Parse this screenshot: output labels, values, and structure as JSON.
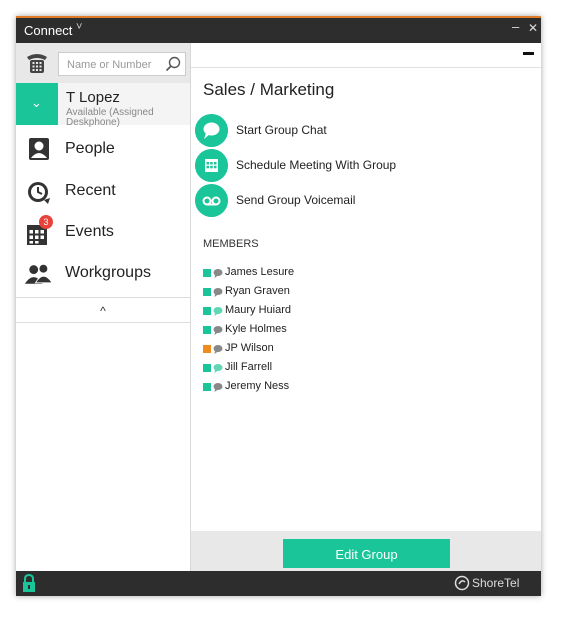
{
  "titlebar": {
    "title": "Connect",
    "chevron": "˅",
    "minimize": "–",
    "close": "✕"
  },
  "search": {
    "placeholder": "Name or Number"
  },
  "user": {
    "name": "T Lopez",
    "status": "Available (Assigned Deskphone)",
    "status_chevron": "⌄"
  },
  "nav": [
    {
      "label": "People",
      "icon": "person-icon"
    },
    {
      "label": "Recent",
      "icon": "clock-icon"
    },
    {
      "label": "Events",
      "icon": "calendar-icon",
      "badge": "3"
    },
    {
      "label": "Workgroups",
      "icon": "group-icon"
    }
  ],
  "collapse_label": "^",
  "group": {
    "title": "Sales / Marketing"
  },
  "actions": [
    {
      "label": "Start Group Chat",
      "icon": "chat-icon"
    },
    {
      "label": "Schedule Meeting With Group",
      "icon": "calendar-grid-icon"
    },
    {
      "label": "Send Group Voicemail",
      "icon": "voicemail-icon"
    }
  ],
  "members_header": "MEMBERS",
  "members": [
    {
      "name": "James Lesure",
      "presence_color": "#1bc59a",
      "chat_color": "#888888"
    },
    {
      "name": "Ryan Graven",
      "presence_color": "#1bc59a",
      "chat_color": "#888888"
    },
    {
      "name": "Maury Huiard",
      "presence_color": "#1bc59a",
      "chat_color": "#5fd6b4"
    },
    {
      "name": "Kyle Holmes",
      "presence_color": "#1bc59a",
      "chat_color": "#888888"
    },
    {
      "name": "JP Wilson",
      "presence_color": "#f08c1e",
      "chat_color": "#888888"
    },
    {
      "name": "Jill Farrell",
      "presence_color": "#1bc59a",
      "chat_color": "#5fd6b4"
    },
    {
      "name": "Jeremy Ness",
      "presence_color": "#1bc59a",
      "chat_color": "#888888"
    }
  ],
  "edit_button": "Edit Group",
  "brand": "ShoreTel",
  "colors": {
    "accent": "#1bc59a",
    "titlebar": "#2d2d2d",
    "top_border": "#e07b2a"
  }
}
